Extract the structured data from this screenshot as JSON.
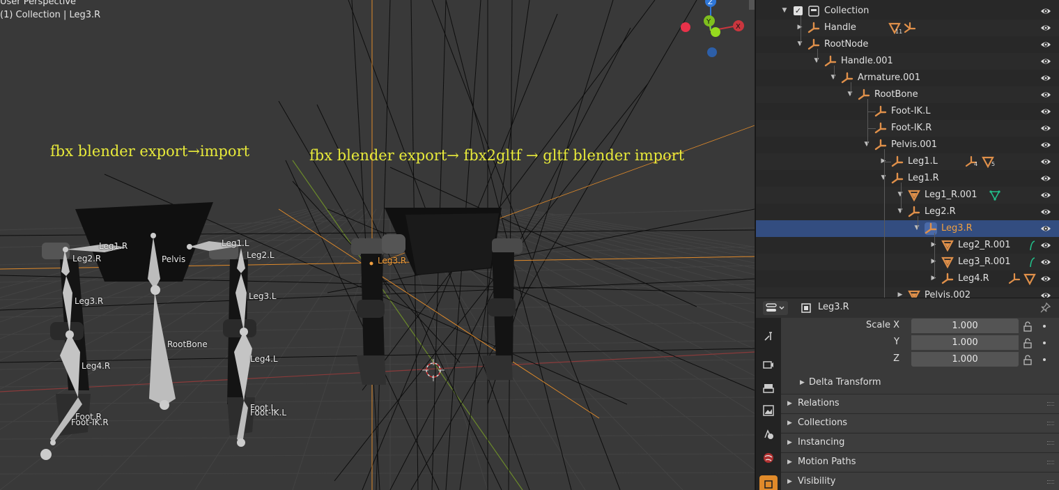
{
  "viewport": {
    "mode_label": "User Perspective",
    "context_label": "(1) Collection | Leg3.R",
    "annotation_left": "fbx blender export→import",
    "annotation_right": "fbx blender export→ fbx2gltf → gltf blender import",
    "bone_labels": [
      "Leg1.R",
      "Leg2.R",
      "Pelvis",
      "Leg1.L",
      "Leg2.L",
      "Leg3.R",
      "Leg3.L",
      "RootBone",
      "Leg4.R",
      "Leg4.L",
      "Foot.R",
      "Foot-IK.R",
      "Foot.L",
      "Foot-IK.L"
    ],
    "active_bone_label": "Leg3.R",
    "gizmo": {
      "z": "Z",
      "y": "Y",
      "x": "X"
    },
    "colors": {
      "background": "#393939",
      "annotation": "#e8ea3a",
      "active": "#f0a040",
      "x_axis": "#c9363e",
      "y_axis": "#8bd11e",
      "z_axis": "#2f77d8"
    }
  },
  "outliner": {
    "rows": [
      {
        "label": "Collection",
        "type": "collection"
      },
      {
        "label": "Handle",
        "type": "empty",
        "badge_count": "11"
      },
      {
        "label": "RootNode",
        "type": "empty"
      },
      {
        "label": "Handle.001",
        "type": "empty"
      },
      {
        "label": "Armature.001",
        "type": "empty"
      },
      {
        "label": "RootBone",
        "type": "empty"
      },
      {
        "label": "Foot-IK.L",
        "type": "empty"
      },
      {
        "label": "Foot-IK.R",
        "type": "empty"
      },
      {
        "label": "Pelvis.001",
        "type": "empty"
      },
      {
        "label": "Leg1.L",
        "type": "empty",
        "badge_a": "4",
        "badge_b": "5"
      },
      {
        "label": "Leg1.R",
        "type": "empty"
      },
      {
        "label": "Leg1_R.001",
        "type": "mesh"
      },
      {
        "label": "Leg2.R",
        "type": "empty"
      },
      {
        "label": "Leg3.R",
        "type": "empty",
        "selected": true
      },
      {
        "label": "Leg2_R.001",
        "type": "mesh"
      },
      {
        "label": "Leg3_R.001",
        "type": "mesh"
      },
      {
        "label": "Leg4.R",
        "type": "empty"
      },
      {
        "label": "Pelvis.002",
        "type": "mesh"
      }
    ]
  },
  "properties": {
    "object_name": "Leg3.R",
    "scale": [
      {
        "label": "Scale X",
        "value": "1.000"
      },
      {
        "label": "Y",
        "value": "1.000"
      },
      {
        "label": "Z",
        "value": "1.000"
      }
    ],
    "delta_transform_label": "Delta Transform",
    "panels": [
      "Relations",
      "Collections",
      "Instancing",
      "Motion Paths",
      "Visibility"
    ]
  }
}
